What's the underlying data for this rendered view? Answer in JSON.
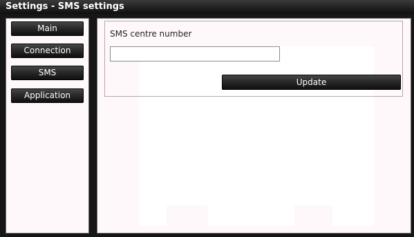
{
  "window": {
    "title": "Settings - SMS settings"
  },
  "sidebar": {
    "items": [
      {
        "label": "Main"
      },
      {
        "label": "Connection"
      },
      {
        "label": "SMS"
      },
      {
        "label": "Application"
      }
    ]
  },
  "sms_form": {
    "centre_number_label": "SMS centre number",
    "centre_number_value": "",
    "update_label": "Update"
  },
  "colors": {
    "button_bg": "#1a1a1a",
    "panel_bg": "#fff8fa",
    "frame_bg": "#161616"
  }
}
